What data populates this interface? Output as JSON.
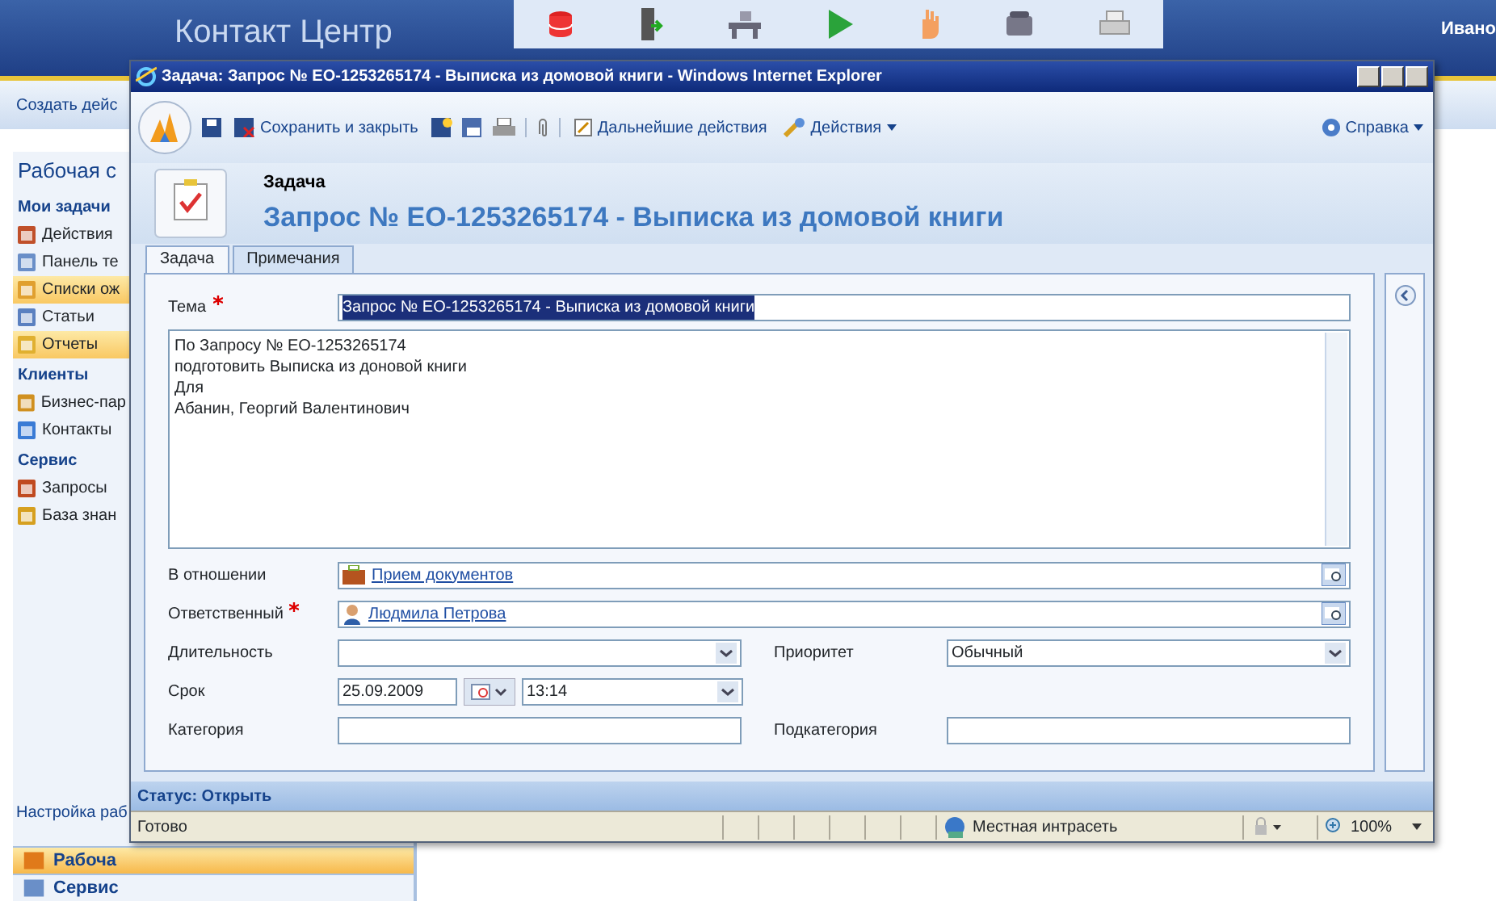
{
  "app": {
    "title": "Контакт Центр",
    "user": "Ивано",
    "create_button": "Создать дейс",
    "workspace_title": "Рабочая с",
    "nav_sections": [
      {
        "title": "Мои задачи",
        "items": [
          {
            "label": "Действия",
            "selected": false
          },
          {
            "label": "Панель те",
            "selected": false
          },
          {
            "label": "Списки ож",
            "selected": true
          },
          {
            "label": "Статьи",
            "selected": false
          },
          {
            "label": "Отчеты",
            "selected": true
          }
        ]
      },
      {
        "title": "Клиенты",
        "items": [
          {
            "label": "Бизнес-пар",
            "selected": false
          },
          {
            "label": "Контакты",
            "selected": false
          }
        ]
      },
      {
        "title": "Сервис",
        "items": [
          {
            "label": "Запросы",
            "selected": false
          },
          {
            "label": "База знан",
            "selected": false
          }
        ]
      }
    ],
    "settings_link": "Настройка раб",
    "bottom_buttons": [
      {
        "label": "Рабоча",
        "selected": true
      },
      {
        "label": "Сервис",
        "selected": false
      }
    ]
  },
  "window": {
    "title": "Задача: Запрос № ЕО-1253265174 - Выписка из домовой книги - Windows Internet Explorer",
    "toolbar": {
      "save_close": "Сохранить и закрыть",
      "more_actions": "Дальнейшие действия",
      "actions": "Действия",
      "help": "Справка"
    },
    "entity": "Задача",
    "record_title": "Запрос № ЕО-1253265174 - Выписка из домовой книги",
    "tabs": [
      {
        "label": "Задача",
        "selected": true
      },
      {
        "label": "Примечания",
        "selected": false
      }
    ],
    "subject": {
      "label": "Тема",
      "required": true,
      "value": "Запрос № ЕО-1253265174 - Выписка из домовой книги"
    },
    "description": [
      "По Запросу № ЕО-1253265174",
      "подготовить Выписка из доновой книги",
      "Для",
      "Абанин, Георгий Валентинович"
    ],
    "lookups": [
      {
        "label": "В отношении",
        "required": false,
        "value": "Прием документов",
        "kind": "case"
      },
      {
        "label": "Ответственный",
        "required": true,
        "value": "Людмила Петрова",
        "kind": "user"
      }
    ],
    "duration": {
      "label": "Длительность"
    },
    "priority": {
      "label": "Приоритет",
      "value": "Обычный"
    },
    "due": {
      "label": "Срок",
      "date": "25.09.2009",
      "time": "13:14"
    },
    "category": {
      "label": "Категория"
    },
    "subcategory": {
      "label": "Подкатегория"
    },
    "status": "Статус: Открыть"
  },
  "ie_status": {
    "text": "Готово",
    "zone": "Местная интрасеть",
    "zoom": "100%"
  }
}
